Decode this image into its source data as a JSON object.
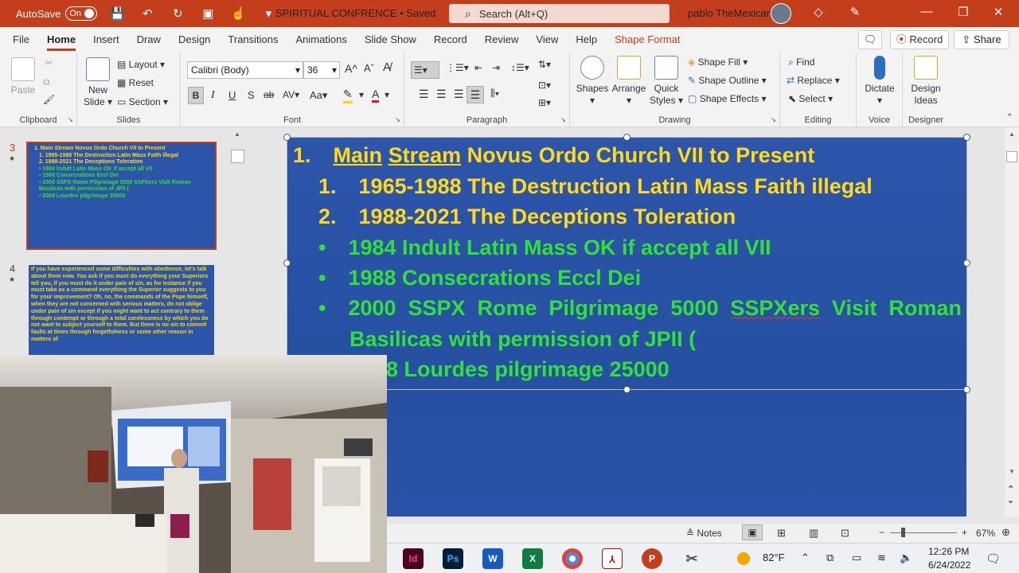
{
  "titlebar": {
    "autosave_label": "AutoSave",
    "autosave_state": "On",
    "doc_title": "SPIRITUAL CONFRENCE • Saved",
    "search_placeholder": "Search (Alt+Q)",
    "user_name": "pablo TheMexican"
  },
  "menu": {
    "tabs": [
      "File",
      "Home",
      "Insert",
      "Draw",
      "Design",
      "Transitions",
      "Animations",
      "Slide Show",
      "Record",
      "Review",
      "View",
      "Help",
      "Shape Format"
    ],
    "active": "Home",
    "record_button": "Record",
    "share_button": "Share"
  },
  "ribbon": {
    "clipboard": {
      "paste": "Paste",
      "label": "Clipboard"
    },
    "slides": {
      "new_slide_1": "New",
      "new_slide_2": "Slide",
      "layout": "Layout",
      "reset": "Reset",
      "section": "Section",
      "label": "Slides"
    },
    "font": {
      "family": "Calibri (Body)",
      "size": "36",
      "label": "Font"
    },
    "paragraph": {
      "label": "Paragraph"
    },
    "drawing": {
      "shapes": "Shapes",
      "arrange": "Arrange",
      "quick_styles_1": "Quick",
      "quick_styles_2": "Styles",
      "shape_fill": "Shape Fill",
      "shape_outline": "Shape Outline",
      "shape_effects": "Shape Effects",
      "label": "Drawing"
    },
    "editing": {
      "find": "Find",
      "replace": "Replace",
      "select": "Select",
      "label": "Editing"
    },
    "voice": {
      "dictate": "Dictate",
      "label": "Voice"
    },
    "designer": {
      "design_ideas_1": "Design",
      "design_ideas_2": "Ideas",
      "label": "Designer"
    }
  },
  "slide_panel": {
    "slide3_number": "3",
    "slide3_lines": [
      "1.    Main Stream Novus Ordo Church VII to Present",
      "1.    1965-1988 The Destruction Latin Mass Faith illegal",
      "2.    1988-2021 The Deceptions Toleration",
      "•   1984 Indult Latin Mass OK if accept all VII",
      "•   1988 Consecrations Eccl Dei",
      "•   2000 SSPX Rome Pilgrimage 5000 SSPXers Visit Roman",
      "     Basilicas with permission of JPII (",
      "•   2008 Lourdes pilgrimage 25000"
    ],
    "slide4_number": "4",
    "slide4_text": "If you have experienced some difficulties with obedience, let's talk about them now. You ask if you must do everything your Superiors tell you, if you must do it under pain of sin, as for instance if you must take as a command everything the Superior suggests to you for your improvement? Oh, no, the commands of the Pope himself, when they are not concerned with serious matters, do not oblige under pain of sin except if you might want to act contrary to them through contempt or through a total carelessness by which you do not want to subject yourself to them. But there is no sin to commit faults at times through forgetfulness or some other reason in matters of"
  },
  "slide": {
    "line1_num": "1.",
    "line1_a": "Main",
    "line1_b": "Stream",
    "line1_c": "Novus Ordo Church VII to Present",
    "line2_num": "1.",
    "line2_text": "1965-1988 The Destruction Latin Mass Faith illegal",
    "line3_num": "2.",
    "line3_text": "1988-2021 The Deceptions Toleration",
    "bullet": "•",
    "b1": "1984 Indult Latin Mass OK if accept all VII",
    "b2": "1988 Consecrations Eccl Dei",
    "b3_words": [
      "2000",
      "SSPX",
      "Rome",
      "Pilgrimage",
      "5000",
      "SSPXers",
      "Visit",
      "Roman"
    ],
    "b3_cont": "Basilicas with permission of JPII (",
    "b4_visible": "08 Lourdes pilgrimage 25000"
  },
  "statusbar": {
    "notes": "Notes",
    "zoom": "67%"
  },
  "taskbar": {
    "weather": "82°F",
    "time": "12:26 PM",
    "date": "6/24/2022"
  },
  "colors": {
    "accent": "#c43e1c",
    "slide_bg": "#2c54a8",
    "yellow_text": "#ffd91a",
    "green_text": "#33e03a"
  }
}
